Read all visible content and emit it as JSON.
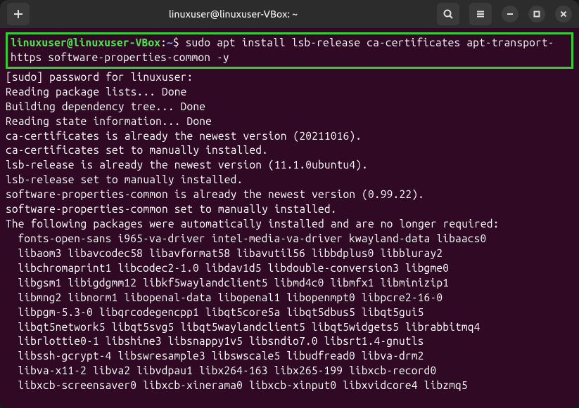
{
  "titlebar": {
    "title": "linuxuser@linuxuser-VBox: ~"
  },
  "prompt": {
    "user_host": "linuxuser@linuxuser-VBox",
    "path": "~",
    "command": "sudo apt install lsb-release ca-certificates apt-transport-https software-properties-common -y"
  },
  "output": {
    "lines": [
      "[sudo] password for linuxuser:",
      "Reading package lists... Done",
      "Building dependency tree... Done",
      "Reading state information... Done",
      "ca-certificates is already the newest version (20211016).",
      "ca-certificates set to manually installed.",
      "lsb-release is already the newest version (11.1.0ubuntu4).",
      "lsb-release set to manually installed.",
      "software-properties-common is already the newest version (0.99.22).",
      "software-properties-common set to manually installed.",
      "The following packages were automatically installed and are no longer required:"
    ],
    "pkg_lines": [
      "fonts-open-sans i965-va-driver intel-media-va-driver kwayland-data libaacs0",
      "libaom3 libavcodec58 libavformat58 libavutil56 libbdplus0 libbluray2",
      "libchromaprint1 libcodec2-1.0 libdav1d5 libdouble-conversion3 libgme0",
      "libgsm1 libigdgmm12 libkf5waylandclient5 libmd4c0 libmfx1 libminizip1",
      "libmng2 libnorm1 libopenal-data libopenal1 libopenmpt0 libpcre2-16-0",
      "libpgm-5.3-0 libqrcodegencpp1 libqt5core5a libqt5dbus5 libqt5gui5",
      "libqt5network5 libqt5svg5 libqt5waylandclient5 libqt5widgets5 librabbitmq4",
      "librlottie0-1 libshine3 libsnappy1v5 libsndio7.0 libsrt1.4-gnutls",
      "libssh-gcrypt-4 libswresample3 libswscale5 libudfread0 libva-drm2",
      "libva-x11-2 libva2 libvdpau1 libx264-163 libx265-199 libxcb-record0",
      "libxcb-screensaver0 libxcb-xinerama0 libxcb-xinput0 libxvidcore4 libzmq5"
    ]
  }
}
